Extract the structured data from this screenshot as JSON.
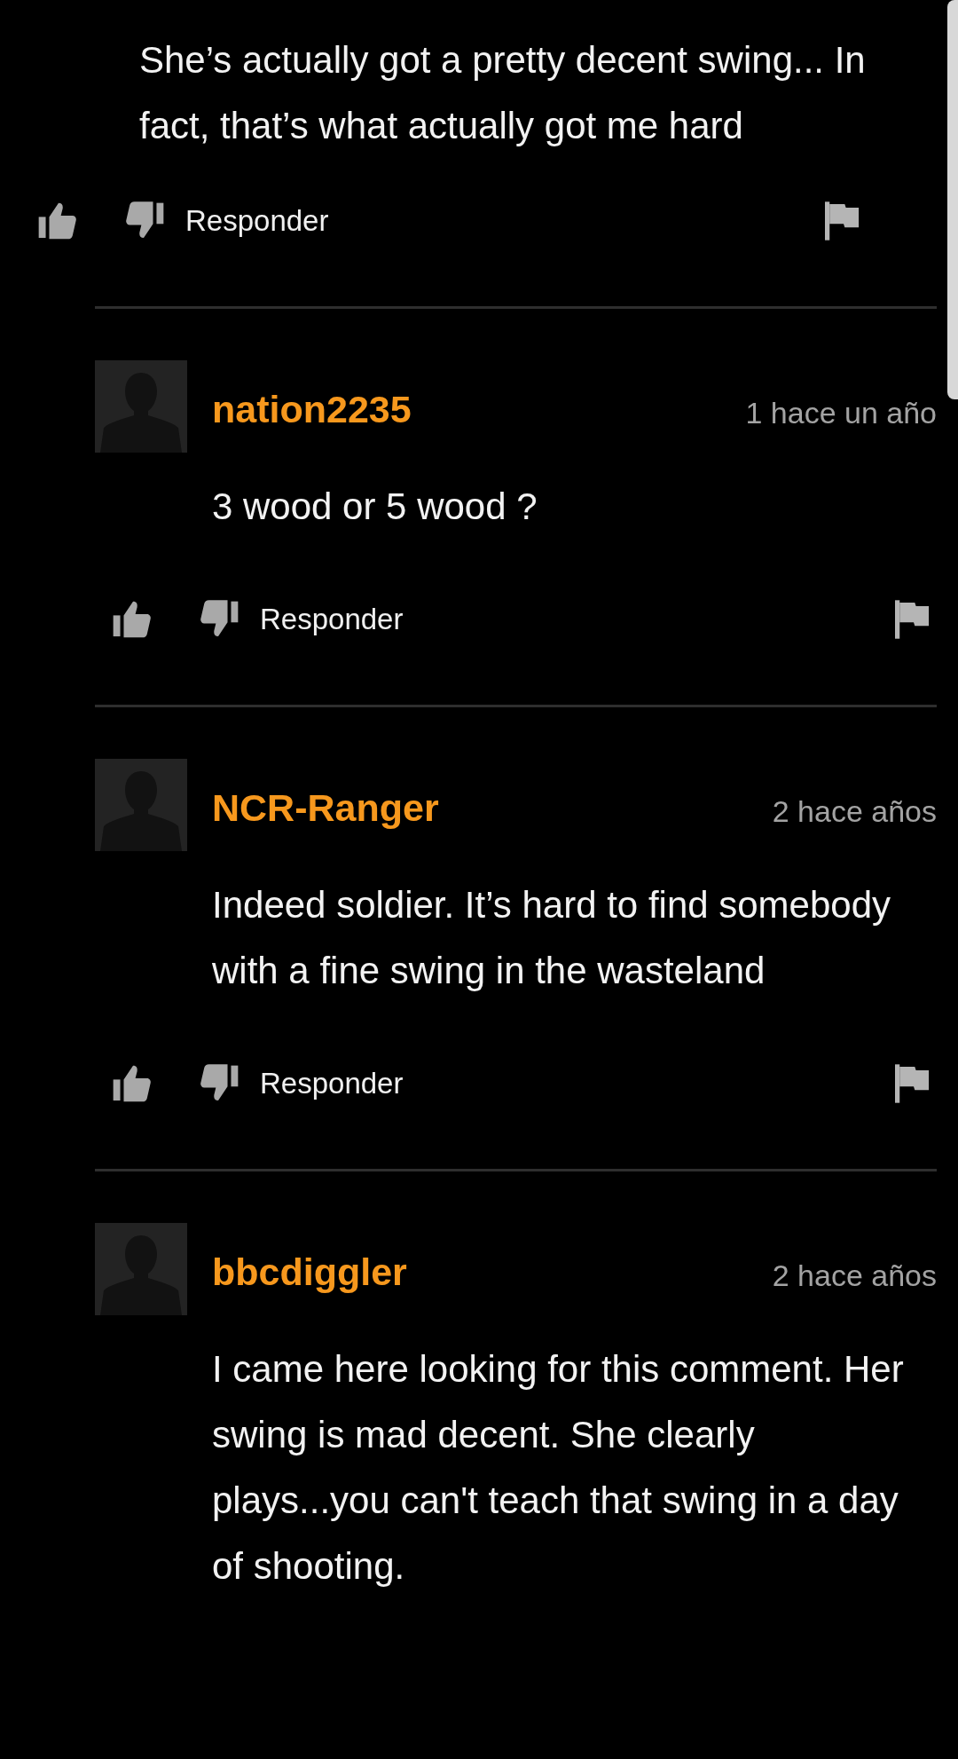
{
  "top_comment": {
    "text": "She’s actually got a pretty decent swing... In fact, that’s what actually got me hard",
    "reply_label": "Responder"
  },
  "replies": [
    {
      "username": "nation2235",
      "time": "1 hace un año",
      "text": "3 wood or 5 wood ?",
      "reply_label": "Responder"
    },
    {
      "username": "NCR-Ranger",
      "time": "2 hace años",
      "text": "Indeed soldier. It’s hard to find somebody with a fine swing in the wasteland",
      "reply_label": "Responder"
    },
    {
      "username": "bbcdiggler",
      "time": "2 hace años",
      "text": "I came here looking for this comment. Her swing is mad decent. She clearly plays...you can't teach that swing in a day of shooting."
    }
  ]
}
